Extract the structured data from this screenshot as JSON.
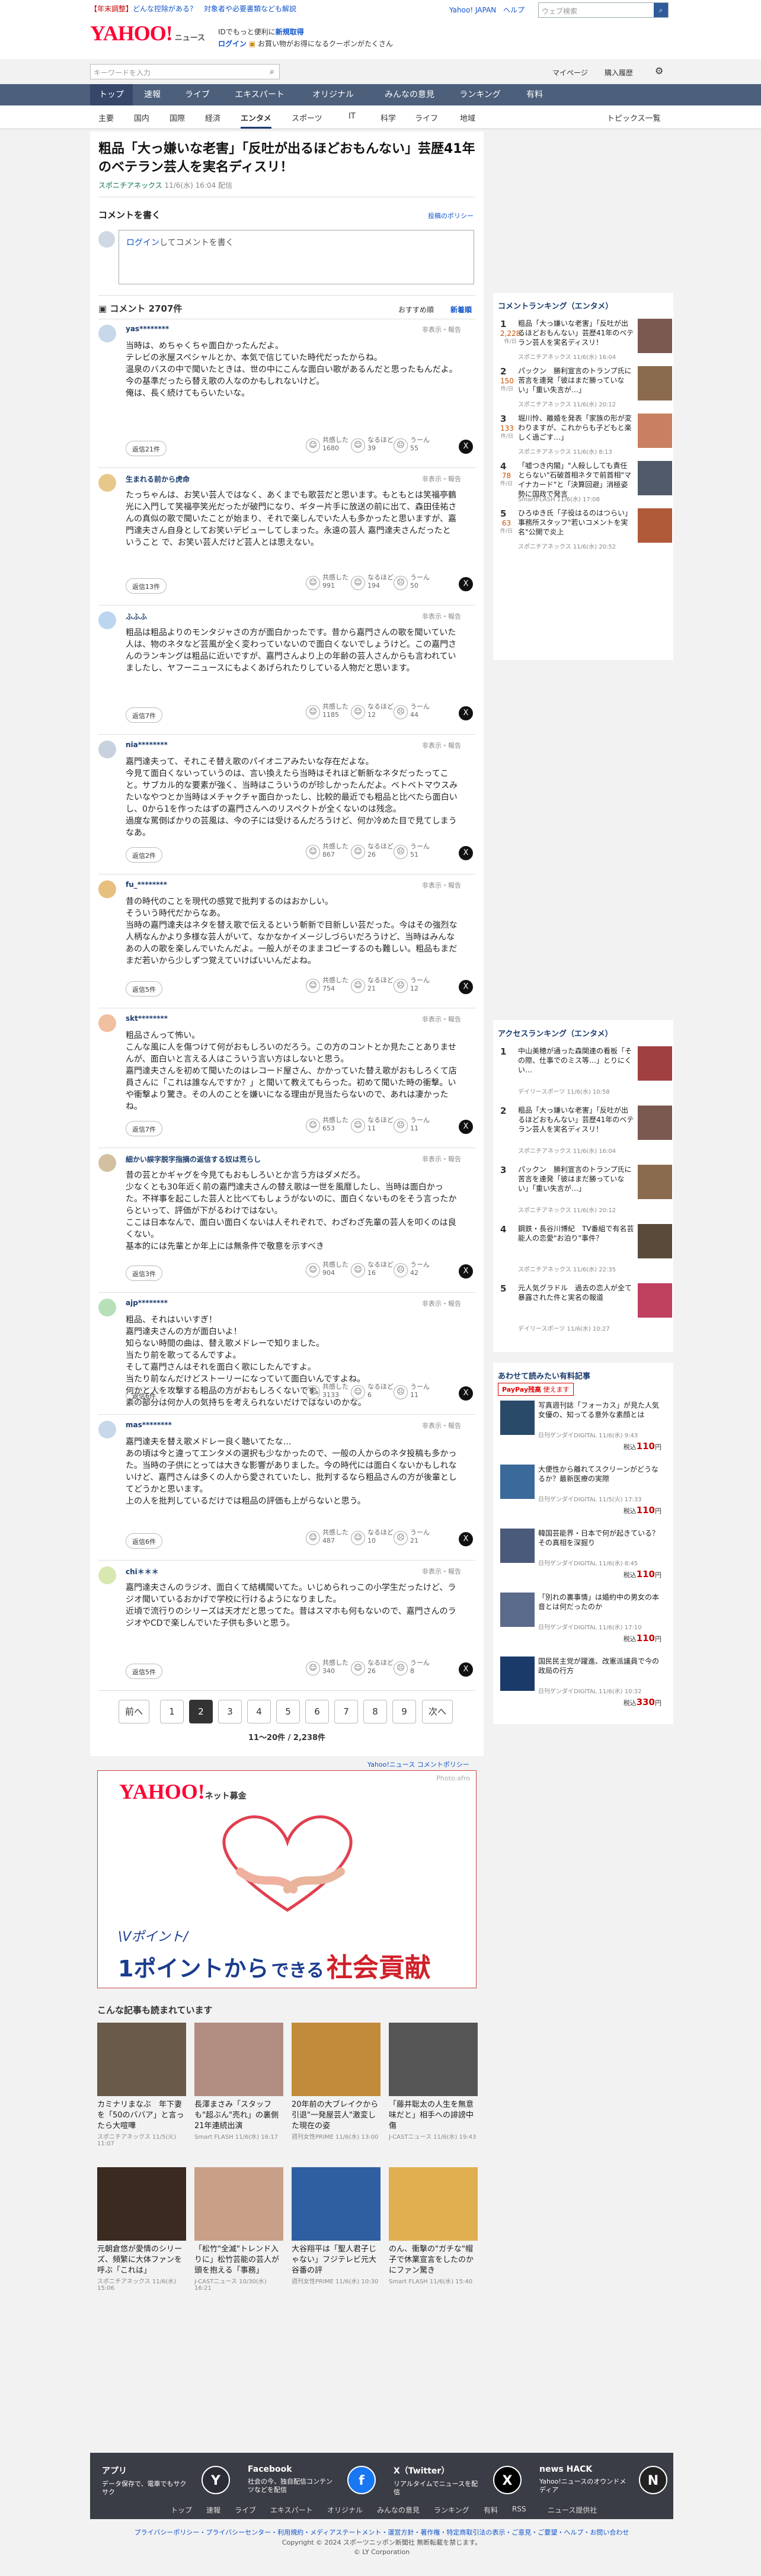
{
  "header": {
    "notice_red": "【年末調整】",
    "notice": "どんな控除がある？　対象者や必要書類なども解説",
    "logo": "YAHOO!",
    "logo_sub": "ニュース",
    "sub_line1": "IDでもっと便利に",
    "sub_line1_link": "新規取得",
    "login": "ログイン",
    "sub_line2": "お買い物がお得になるクーポンがたくさん",
    "top_links": [
      "Yahoo! JAPAN",
      "ヘルプ"
    ],
    "search_placeholder": "ウェブ検索",
    "news_search_placeholder": "キーワードを入力",
    "mypage": "マイページ",
    "purchased": "購入履歴"
  },
  "nav": [
    "トップ",
    "速報",
    "ライブ",
    "エキスパート",
    "オリジナル",
    "みんなの意見",
    "ランキング",
    "有料"
  ],
  "subnav": [
    "主要",
    "国内",
    "国際",
    "経済",
    "エンタメ",
    "スポーツ",
    "IT",
    "科学",
    "ライフ",
    "地域"
  ],
  "subnav_right": "トピックス一覧",
  "article": {
    "title": "粗品「大っ嫌いな老害」「反吐が出るほどおもんない」芸歴41年のベテラン芸人を実名ディスリ！",
    "source": "スポニチアネックス",
    "date": "11/6(水) 16:04 配信"
  },
  "comment_form": {
    "heading": "コメントを書く",
    "policy": "投稿のポリシー",
    "login": "ログイン",
    "prompt": "してコメントを書く"
  },
  "comments_header": {
    "label": "コメント 2707件",
    "sort_recommended": "おすすめ順",
    "sort_new": "新着順"
  },
  "comments": [
    {
      "name": "yas********",
      "time": "11時間前",
      "body": [
        "当時は、めちゃくちゃ面白かったんだよ。",
        "テレビの氷屋スペシャルとか、本気で信じていた時代だったからね。",
        "温泉のバスの中で聞いたときは、世の中にこんな面白い歌があるんだと思ったもんだよ。",
        "今の基準だったら替え歌の人なのかもしれないけど。",
        "俺は、長く続けてもらいたいな。"
      ],
      "replies": "返信21件",
      "likes": [
        "共感した",
        "1680"
      ],
      "hmm": [
        "なるほど",
        "39"
      ],
      "uun": [
        "うーん",
        "55"
      ]
    },
    {
      "name": "生まれる前から虎命",
      "time": "9時間前",
      "body": [
        "たっちゃんは、お笑い芸人ではなく、あくまでも歌芸だと思います。もともとは笑福亭鶴光に入門して笑福亭笑光だったが破門になり、ギター片手に放送の前に出て、森田佳祐さんの真似の歌で聞いたことが始まり、それで楽しんでいた人も多かったと思いますが、嘉門達夫さん自身としてお笑いデビューしてしまった。永遠の芸人 嘉門達夫さんだったということ で、お笑い芸人だけど芸人とは思えない。"
      ],
      "replies": "返信13件",
      "likes": [
        "共感した",
        "991"
      ],
      "hmm": [
        "なるほど",
        "194"
      ],
      "uun": [
        "うーん",
        "50"
      ]
    },
    {
      "name": "ふふふ",
      "time": "9時間前",
      "body": [
        "粗品は粗品よりのモンタジャさの方が面白かったです。昔から嘉門さんの歌を聞いていた人は、物のネタなど芸風が全く変わっていないので面白くないでしょうけど。この嘉門さんのランキングは粗品に近いですが、嘉門さんより上の年齢の芸人さんからも言われていましたし、ヤフーニュースにもよくあげられたりしている人物だと思います。"
      ],
      "replies": "返信7件",
      "likes": [
        "共感した",
        "1185"
      ],
      "hmm": [
        "なるほど",
        "12"
      ],
      "uun": [
        "うーん",
        "44"
      ]
    },
    {
      "name": "nia********",
      "time": "10時間前",
      "body": [
        "嘉門達夫って、それこそ替え歌のパイオニアみたいな存在だよな。",
        "今見て面白くないっていうのは、言い換えたら当時はそれほど斬新なネタだったってこと。サブカル的な要素が強く、当時はこういうのが珍しかったんだよ。ベトベトマウスみたいなやつとか当時はメチャクチャ面白かったし、比較的最近でも粗品と比べたら面白いし、0から1を作ったはずの嘉門さんへのリスペクトが全くないのは残念。",
        "過度な罵倒ばかりの芸風は、今の子には受けるんだろうけど、何か冷めた目で見てしまうなあ。"
      ],
      "replies": "返信2件",
      "likes": [
        "共感した",
        "867"
      ],
      "hmm": [
        "なるほど",
        "26"
      ],
      "uun": [
        "うーん",
        "51"
      ]
    },
    {
      "name": "fu_********",
      "time": "7時間前",
      "body": [
        "昔の時代のことを現代の感覚で批判するのはおかしい。",
        "そういう時代だからなあ。",
        "当時の嘉門達夫はネタを替え歌で伝えるという斬新で目新しい芸だった。今はその強烈な人柄なんかより多様な芸人がいて、なかなかイメージしづらいだろうけど、当時はみんなあの人の歌を楽しんでいたんだよ。一般人がそのままコピーするのも難しい。粗品もまだまだ若いから少しずつ覚えていけばいいんだよね。"
      ],
      "replies": "返信5件",
      "likes": [
        "共感した",
        "754"
      ],
      "hmm": [
        "なるほど",
        "21"
      ],
      "uun": [
        "うーん",
        "12"
      ]
    },
    {
      "name": "skt********",
      "time": "8時間前",
      "body": [
        "粗品さんって怖い。",
        "こんな風に人を傷つけて何がおもしろいのだろう。この方のコントとか見たことありませんが、面白いと言える人はこういう言い方はしないと思う。",
        "嘉門達夫さんを初めて聞いたのはレコード屋さん、かかっていた替え歌がおもしろくて店員さんに「これは誰なんですか？」と聞いて教えてもらった。初めて聞いた時の衝撃。いや衝撃より驚き。その人のことを嫌いになる理由が見当たらないので、あれは凄かったね。"
      ],
      "replies": "返信7件",
      "likes": [
        "共感した",
        "653"
      ],
      "hmm": [
        "なるほど",
        "11"
      ],
      "uun": [
        "うーん",
        "11"
      ]
    },
    {
      "name": "細かい誤字脱字指摘の返信する奴は荒らし",
      "time": "10時間前",
      "body": [
        "昔の芸とかギャグを今見てもおもしろいとか言う方はダメだろ。",
        "少なくとも30年近く前の嘉門達夫さんの替え歌は一世を風靡したし、当時は面白かった。不祥事を起こした芸人と比べてもしょうがないのに、面白くないものをそう言ったからといって、評価が下がるわけではない。",
        "ここは日本なんで、面白い面白くないは人それぞれで、わざわざ先輩の芸人を叩くのは良くない。",
        "基本的には先輩とか年上には無条件で敬意を示すべき"
      ],
      "replies": "返信3件",
      "likes": [
        "共感した",
        "904"
      ],
      "hmm": [
        "なるほど",
        "16"
      ],
      "uun": [
        "うーん",
        "42"
      ]
    },
    {
      "name": "ajp********",
      "time": "10時間前",
      "body": [
        "粗品、それはいいすぎ！",
        "嘉門達夫さんの方が面白いよ！",
        "知らない時間の曲は、替え歌メドレーで知りました。",
        "当たり前を歌ってるんですよ。",
        "そして嘉門さんはそれを面白く歌にしたんですよ。",
        "当たり前なんだけどストーリーになっていて面白いんですよね。",
        "何かと人を攻撃する粗品の方がおもしろくないです。",
        "素の部分は何か人の気持ちを考えられないだけではないのかな。"
      ],
      "replies": "返信6件",
      "likes": [
        "共感した",
        "3133"
      ],
      "hmm": [
        "なるほど",
        "6"
      ],
      "uun": [
        "うーん",
        "11"
      ]
    },
    {
      "name": "mas********",
      "time": "10時間前",
      "body": [
        "嘉門達夫を替え歌メドレー良く聴いてたな…",
        "あの頃は今と違ってエンタメの選択も少なかったので、一般の人からのネタ投稿も多かった。当時の子供にとっては大きな影響がありました。今の時代には面白くないかもしれないけど、嘉門さんは多くの人から愛されていたし、批判するなら粗品さんの方が後輩としてどうかと思います。",
        "上の人を批判しているだけでは粗品の評価も上がらないと思う。"
      ],
      "replies": "返信6件",
      "likes": [
        "共感した",
        "487"
      ],
      "hmm": [
        "なるほど",
        "10"
      ],
      "uun": [
        "うーん",
        "21"
      ]
    },
    {
      "name": "chi＊＊＊",
      "time": "9時間前",
      "body": [
        "嘉門達夫さんのラジオ、面白くて結構聞いてた。いじめられっこの小学生だったけど、ラジオ聞いているおかげで学校に行けるようになりました。",
        "近頃で流行りのシリーズは天才だと思ってた。昔はスマホも何もないので、嘉門さんのラジオやCDで楽しんでいた子供も多いと思う。"
      ],
      "replies": "返信5件",
      "likes": [
        "共感した",
        "340"
      ],
      "hmm": [
        "なるほど",
        "26"
      ],
      "uun": [
        "うーん",
        "8"
      ]
    }
  ],
  "common": {
    "report": "非表示・報告",
    "reply_btn": "返信"
  },
  "pagination": {
    "prev": "前へ",
    "next": "次へ",
    "pages": [
      "1",
      "2",
      "3",
      "4",
      "5",
      "6",
      "7",
      "8",
      "9"
    ],
    "current": "2",
    "range": "11〜20件 / 2,238件"
  },
  "ad": {
    "header": "Yahoo!ニュース コメントポリシー",
    "logo": "YAHOO!",
    "logo_sub": "ネット募金",
    "photo": "Photo:afro",
    "tag": "Vポイント",
    "line1": "1ポイントから",
    "line2": "できる",
    "line3": "社会貢献"
  },
  "also_read": {
    "heading": "こんな記事も読まれています",
    "items": [
      {
        "t": "カミナリまなぶ　年下妻を「50のババア」と言ったら大喧嘩",
        "s": "スポニチアネックス 11/5(火) 11:07",
        "c": "#6a5a4a"
      },
      {
        "t": "長澤まさみ「スタッフも\"超ぶん\"売れ」の裏側　21年連続出演",
        "s": "Smart FLASH 11/6(水) 16:17",
        "c": "#b08d80"
      },
      {
        "t": "20年前の大ブレイクから引退\"一発屋芸人\"激変した現在の姿",
        "s": "週刊女性PRIME 11/6(水) 13:00",
        "c": "#c08a3a"
      },
      {
        "t": "「藤井聡太の人生を無意味だと」相手への誹謗中傷",
        "s": "J-CASTニュース 11/6(水) 19:43",
        "c": "#555"
      },
      {
        "t": "元朝倉悠が愛情のシリーズ、頻繁に大体ファンを呼ぶ「これは」",
        "s": "スポニチアネックス 11/6(水) 15:06",
        "c": "#3a2a20"
      },
      {
        "t": "「松竹\"全滅\"トレンド入りに」松竹芸能の芸人が頭を抱える「事務」",
        "s": "J-CASTニュース 10/30(水) 16:21",
        "c": "#c7a087"
      },
      {
        "t": "大谷翔平は「聖人君子じゃない」フジテレビ元大谷番の評",
        "s": "週刊女性PRIME 11/6(水) 10:30",
        "c": "#2f5fa0"
      },
      {
        "t": "のん、衝撃の\"ガチな\"帽子で休業宣言をしたのかにファン驚き",
        "s": "Smart FLASH 11/6(水) 15:40",
        "c": "#e0b050"
      }
    ]
  },
  "side_comment_ranking": {
    "heading": "コメントランキング（エンタメ）",
    "items": [
      {
        "n": "1",
        "cnt": "2,228",
        "unit": "件/日",
        "t": "粗品「大っ嫌いな老害」「反吐が出るほどおもんない」芸歴41年のベテラン芸人を実名ディスリ！",
        "s": "スポニチアネックス 11/6(水) 16:04",
        "c": "#7a5a50"
      },
      {
        "n": "2",
        "cnt": "150",
        "unit": "件/日",
        "t": "パックン　勝利宣言のトランプ氏に苦言を連発「彼はまだ勝っていない」「重い失言が…」",
        "s": "スポニチアネックス 11/6(水) 20:12",
        "c": "#8a6b4e"
      },
      {
        "n": "3",
        "cnt": "133",
        "unit": "件/日",
        "t": "堀川怜、離婚を発表「家族の形が変わりますが、これからも子どもと楽しく過ごす…」",
        "s": "スポニチアネックス 11/6(水) 8:13",
        "c": "#c88060"
      },
      {
        "n": "4",
        "cnt": "78",
        "unit": "件/日",
        "t": "「嘘つき内閣」\"人殺ししても責任とらない\"石破首相ネタで前首相\"マイナカード\"と「決算回避」消極姿勢に国政で発言",
        "s": "SmartFLASH 11/6(水) 17:08",
        "c": "#505a6a"
      },
      {
        "n": "5",
        "cnt": "63",
        "unit": "件/日",
        "t": "ひろゆき氏「子役はるのはつらい」事務所スタッフ\"若いコメントを実名\"公開で炎上",
        "s": "スポニチアネックス 11/6(水) 20:52",
        "c": "#b05a3a"
      }
    ]
  },
  "side_access_ranking": {
    "heading": "アクセスランキング（エンタメ）",
    "items": [
      {
        "n": "1",
        "t": "中山美穂が通った森関連の看板「その際、仕事でのミス等…」とりにくい…",
        "s": "デイリースポーツ 11/6(水) 10:58",
        "c": "#a04040"
      },
      {
        "n": "2",
        "t": "粗品「大っ嫌いな老害」「反吐が出るほどおもんない」芸歴41年のベテラン芸人を実名ディスリ！",
        "s": "スポニチアネックス 11/6(水) 16:04",
        "c": "#7a5a50"
      },
      {
        "n": "3",
        "t": "パックン　勝利宣言のトランプ氏に苦言を連発「彼はまだ勝っていない」「重い失言が…」",
        "s": "スポニチアネックス 11/6(水) 20:12",
        "c": "#8a6b4e"
      },
      {
        "n": "4",
        "t": "鋼鉄・長谷川博紀　TV番組で有名芸能人の恋愛\"お泊り\"事件？",
        "s": "スポニチアネックス 11/6(水) 22:35",
        "c": "#5a4a3a"
      },
      {
        "n": "5",
        "t": "元人気グラドル　過去の恋人が全て暴露された件と実名の報道",
        "s": "デイリースポーツ 11/6(水) 10:27",
        "c": "#c04060"
      }
    ]
  },
  "side_books": {
    "heading": "あわせて読みたい有料記事",
    "badge": "PayPay残高",
    "badge_sub": "使えます",
    "items": [
      {
        "t": "写真週刊誌「フォーカス」が見た人気女優の、知ってる意外な素顔とは",
        "s": "日刊ゲンダイDIGITAL 11/6(水) 9:43",
        "p": "110",
        "c": "#2a4a6a"
      },
      {
        "t": "大便性から離れてスクリーンがどうなるか？最新医療の実際",
        "s": "日刊ゲンダイDIGITAL 11/5(火) 17:33",
        "p": "110",
        "c": "#3a6a9a"
      },
      {
        "t": "韓国芸能界・日本で何が起きている？その真相を深掘り",
        "s": "日刊ゲンダイDIGITAL 11/6(水) 8:45",
        "p": "110",
        "c": "#4a5a7a"
      },
      {
        "t": "「別れの裏事情」は婚約中の男女の本音とは何だったのか",
        "s": "日刊ゲンダイDIGITAL 11/6(水) 17:10",
        "p": "110",
        "c": "#5a6a8a"
      },
      {
        "t": "国民民主党が躍進、改憲派議員で今の政局の行方",
        "s": "日刊ゲンダイDIGITAL 11/6(水) 10:32",
        "p": "330",
        "c": "#1a3a6a"
      }
    ]
  },
  "footer": {
    "cols": [
      {
        "title": "アプリ",
        "desc": "データ保存で、電車でもサクサク",
        "icon": "Y"
      },
      {
        "title": "Facebook",
        "desc": "社会の今、独自配信コンテンツなどを配信",
        "icon": "f"
      },
      {
        "title": "X（Twitter）",
        "desc": "リアルタイムでニュースを配信",
        "icon": "X"
      },
      {
        "title": "news HACK",
        "desc": "Yahoo!ニュースのオウンドメディア",
        "icon": "N"
      }
    ],
    "links": [
      "トップ",
      "速報",
      "ライブ",
      "エキスパート",
      "オリジナル",
      "みんなの意見",
      "ランキング",
      "有料",
      "RSS",
      "ニュース提供社"
    ],
    "links2": "プライバシーポリシー・プライバシーセンター・利用規約・メディアステートメント・運営方針・著作権・特定商取引法の表示・ご意見・ご要望・ヘルプ・お問い合わせ",
    "copy1": "Copyright © 2024 スポーツニッポン新聞社 無断転載を禁じます。",
    "copy2": "© LY Corporation"
  }
}
